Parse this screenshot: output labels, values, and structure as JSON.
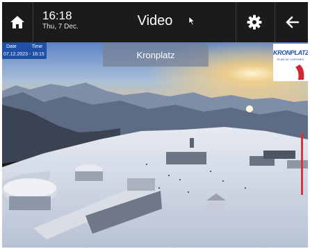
{
  "header": {
    "time": "16:18",
    "date": "Thu, 7 Dec.",
    "title": "Video",
    "home_icon": "home-icon",
    "settings_icon": "gear-icon",
    "back_icon": "arrow-left-icon"
  },
  "camera": {
    "name": "Kronplatz",
    "stamp_date_label": "Date",
    "stamp_time_label": "Time",
    "stamp_value": "07.12.2023 - 16:15",
    "brand_name": "KRONPLATZ",
    "brand_sub": "PLAN DE CORONES"
  },
  "colors": {
    "bar_background": "#1b1b1b",
    "stamp_blue": "#1f4fa6",
    "brand_red": "#d22630"
  }
}
